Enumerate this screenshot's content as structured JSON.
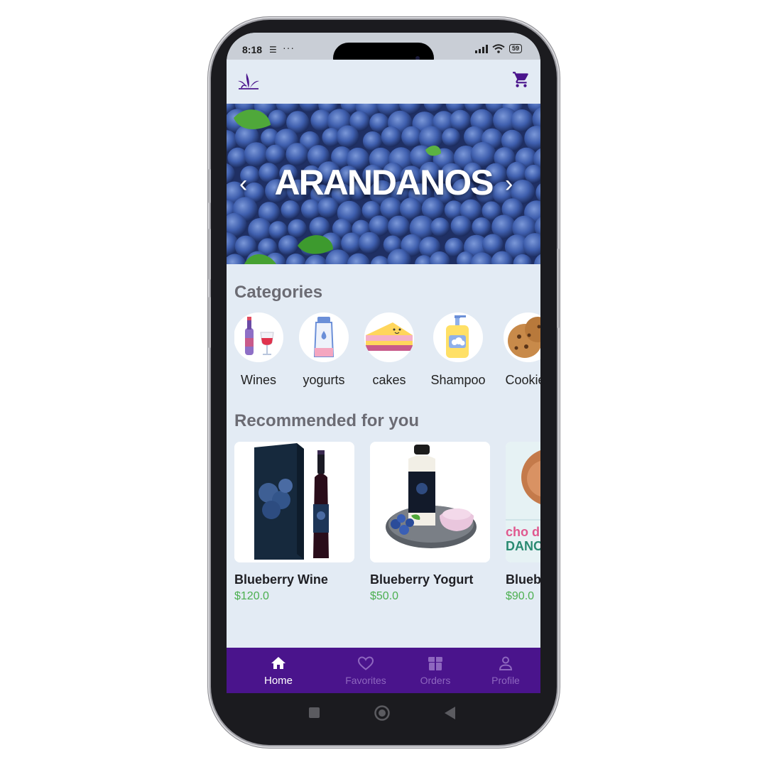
{
  "status": {
    "time": "8:18",
    "more": "···",
    "battery": "59"
  },
  "banner": {
    "title": "ARANDANOS"
  },
  "categories": {
    "title": "Categories",
    "items": [
      {
        "label": "Wines",
        "icon": "wine-icon"
      },
      {
        "label": "yogurts",
        "icon": "yogurt-icon"
      },
      {
        "label": "cakes",
        "icon": "cake-icon"
      },
      {
        "label": "Shampoo",
        "icon": "shampoo-icon"
      },
      {
        "label": "Cookies",
        "icon": "cookie-icon"
      }
    ]
  },
  "recommended": {
    "title": "Recommended for you",
    "items": [
      {
        "name": "Blueberry Wine",
        "price": "$120.0"
      },
      {
        "name": "Blueberry Yogurt",
        "price": "$50.0"
      },
      {
        "name": "Blueberry Cake",
        "price": "$90.0",
        "image_text": "cho d / DANO"
      }
    ]
  },
  "bottom_nav": {
    "items": [
      {
        "label": "Home",
        "icon": "home-icon",
        "active": true
      },
      {
        "label": "Favorites",
        "icon": "heart-icon",
        "active": false
      },
      {
        "label": "Orders",
        "icon": "box-icon",
        "active": false
      },
      {
        "label": "Profile",
        "icon": "person-icon",
        "active": false
      }
    ]
  },
  "colors": {
    "primary": "#4a148c",
    "background": "#e3ebf4",
    "price": "#4caf50",
    "inactive_nav": "#8e67bf"
  }
}
